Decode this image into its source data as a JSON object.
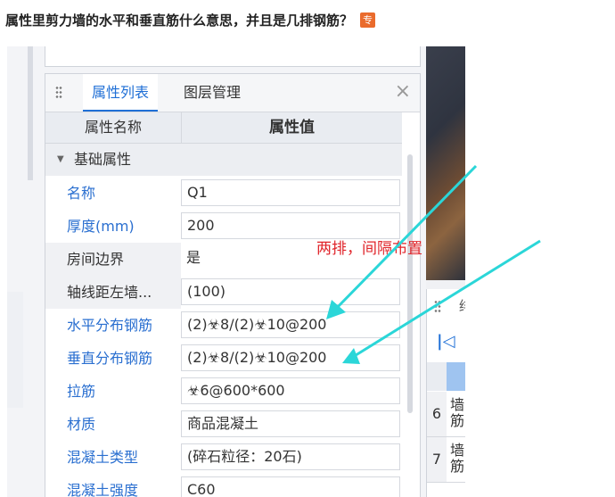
{
  "question": {
    "title": "属性里剪力墙的水平和垂直筋什么意思，并且是几排钢筋？",
    "badge": "专"
  },
  "panel": {
    "tabs": [
      {
        "label": "属性列表",
        "active": true
      },
      {
        "label": "图层管理",
        "active": false
      }
    ],
    "close_glyph": "×",
    "header": {
      "name": "属性名称",
      "value": "属性值"
    },
    "group": {
      "label": "基础属性",
      "toggle_glyph": "▼"
    },
    "rows": [
      {
        "name": "名称",
        "value": "Q1",
        "blue": true
      },
      {
        "name": "厚度(mm)",
        "value": "200",
        "blue": true
      },
      {
        "name": "房间边界",
        "value": "是",
        "blue": false
      },
      {
        "name": "轴线距左墙...",
        "value": "(100)",
        "blue": false
      },
      {
        "name": "水平分布钢筋",
        "value": "(2)☣8/(2)☣10@200",
        "blue": true
      },
      {
        "name": "垂直分布钢筋",
        "value": "(2)☣8/(2)☣10@200",
        "blue": true
      },
      {
        "name": "拉筋",
        "value": "☣6@600*600",
        "blue": true
      },
      {
        "name": "材质",
        "value": "商品混凝土",
        "blue": true
      },
      {
        "name": "混凝土类型",
        "value": "(碎石粒径：20石)",
        "blue": true
      },
      {
        "name": "混凝土强度",
        "value": "C60",
        "blue": true
      }
    ]
  },
  "annotation": {
    "text": "两排，间隔布置",
    "color": "#e0242a",
    "arrow_color": "#2bd6d8"
  },
  "right_panel": {
    "title_fragment": "绯",
    "first_glyph": "|◁",
    "rows": [
      {
        "num": "6",
        "text": "墙筋"
      },
      {
        "num": "7",
        "text": "墙筋"
      }
    ]
  }
}
